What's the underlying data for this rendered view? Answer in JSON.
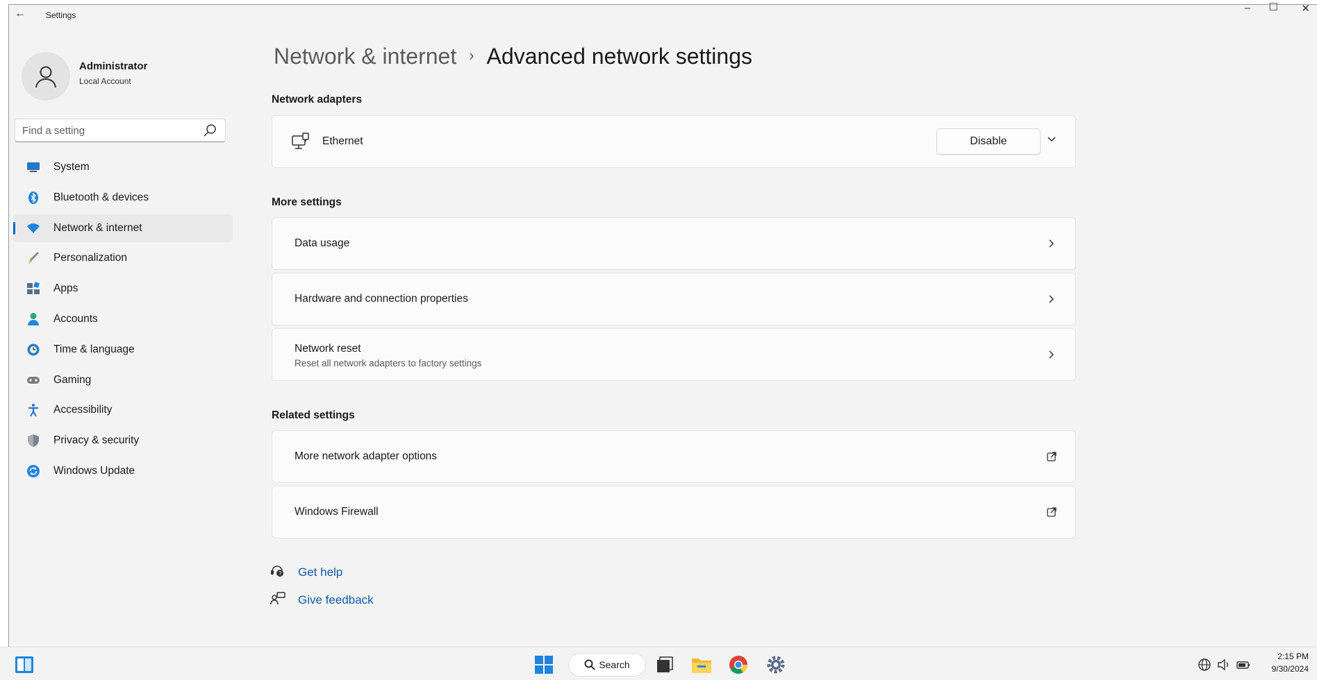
{
  "window": {
    "app_title": "Settings",
    "minimize": "–",
    "maximize": "☐",
    "close": "✕"
  },
  "user": {
    "name": "Administrator",
    "account_type": "Local Account"
  },
  "search": {
    "placeholder": "Find a setting"
  },
  "nav": [
    {
      "label": "System",
      "icon": "monitor-icon",
      "color": "#2378c8"
    },
    {
      "label": "Bluetooth & devices",
      "icon": "bluetooth-icon",
      "color": "#1f84e0"
    },
    {
      "label": "Network & internet",
      "icon": "wifi-icon",
      "color": "#1f84e0",
      "active": true
    },
    {
      "label": "Personalization",
      "icon": "brush-icon",
      "color": "#e08a2e"
    },
    {
      "label": "Apps",
      "icon": "apps-icon",
      "color": "#5b6d86"
    },
    {
      "label": "Accounts",
      "icon": "person-icon",
      "color": "#2fa676"
    },
    {
      "label": "Time & language",
      "icon": "globe-clock-icon",
      "color": "#2a7fc5"
    },
    {
      "label": "Gaming",
      "icon": "gamepad-icon",
      "color": "#7a7a7a"
    },
    {
      "label": "Accessibility",
      "icon": "accessibility-icon",
      "color": "#1f6fd0"
    },
    {
      "label": "Privacy & security",
      "icon": "shield-icon",
      "color": "#7b8591"
    },
    {
      "label": "Windows Update",
      "icon": "update-icon",
      "color": "#1f84e0"
    }
  ],
  "breadcrumb": {
    "parent": "Network & internet",
    "separator": "›",
    "current": "Advanced network settings"
  },
  "sections": {
    "adapters": "Network adapters",
    "more": "More settings",
    "related": "Related settings"
  },
  "adapter": {
    "name": "Ethernet",
    "button": "Disable"
  },
  "more_settings": [
    {
      "title": "Data usage"
    },
    {
      "title": "Hardware and connection properties"
    },
    {
      "title": "Network reset",
      "subtitle": "Reset all network adapters to factory settings"
    }
  ],
  "related_settings": [
    {
      "title": "More network adapter options"
    },
    {
      "title": "Windows Firewall"
    }
  ],
  "help": {
    "get_help": "Get help",
    "give_feedback": "Give feedback"
  },
  "taskbar": {
    "search_label": "Search",
    "time": "2:15 PM",
    "date": "9/30/2024"
  },
  "accent_color": "#0067c0"
}
